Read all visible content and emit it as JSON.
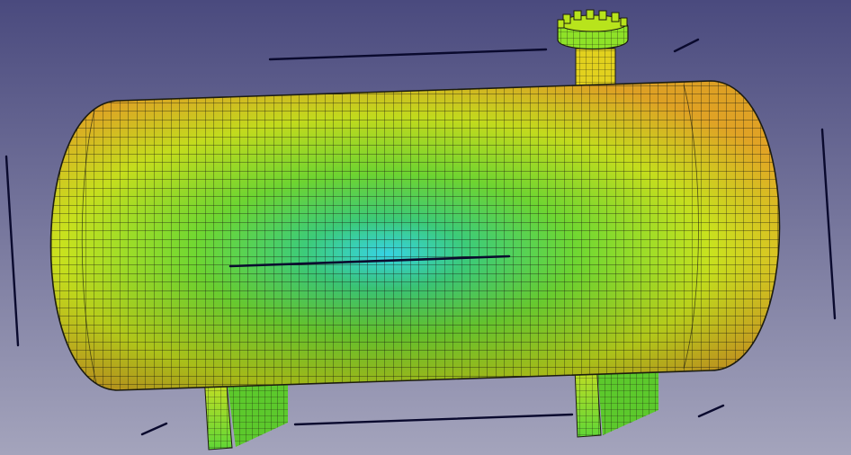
{
  "scene": {
    "background_top": "#4a4a7e",
    "background_bottom": "#a4a4bc",
    "mesh_line_color": "#1c1c10",
    "annotation_line_color": "#0a0a2e",
    "colormap": [
      "#36d3e3",
      "#3ccc7a",
      "#6fd832",
      "#c9e21e",
      "#e8a826"
    ],
    "objects": [
      "horizontal-pressure-vessel",
      "left-saddle-support",
      "right-saddle-support",
      "top-nozzle-flange"
    ]
  }
}
